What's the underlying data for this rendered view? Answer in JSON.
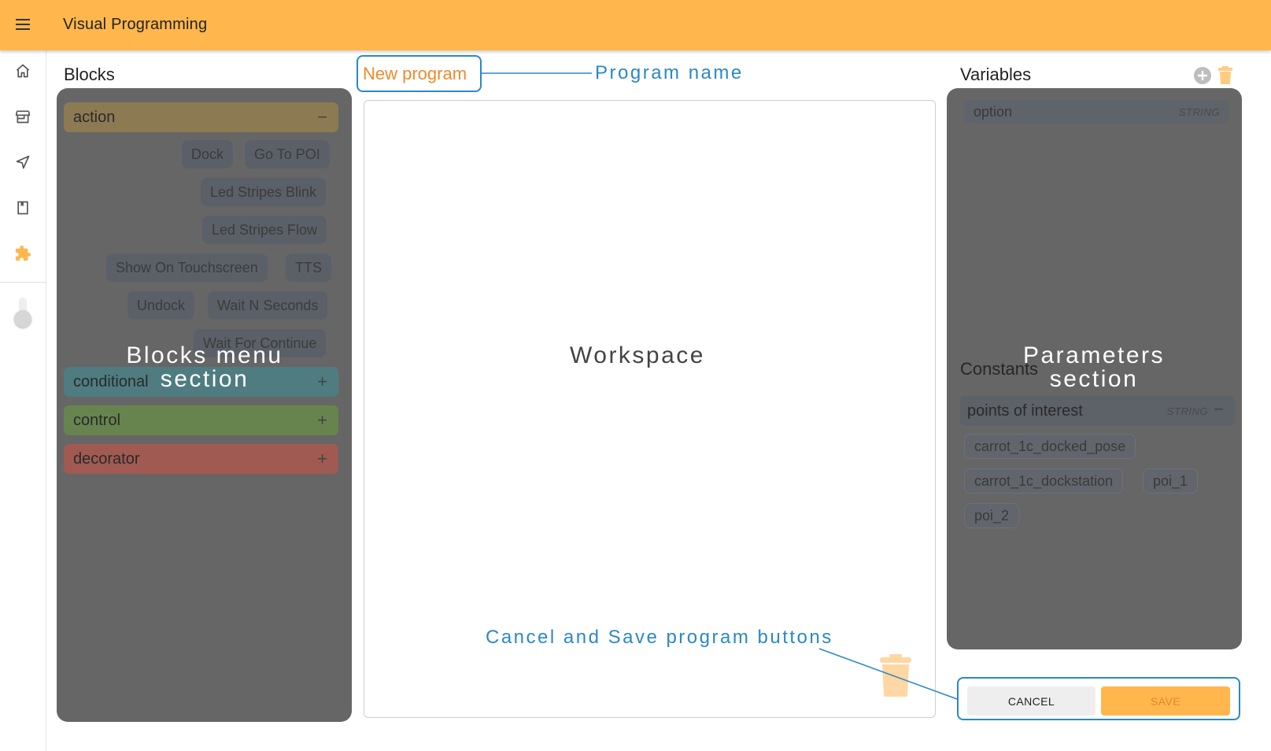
{
  "app": {
    "title": "Visual Programming"
  },
  "nav": {
    "items": [
      {
        "icon": "home-icon"
      },
      {
        "icon": "store-icon"
      },
      {
        "icon": "send-icon"
      },
      {
        "icon": "bookmark-icon"
      },
      {
        "icon": "puzzle-icon"
      }
    ],
    "accent": "#ffb74d"
  },
  "headings": {
    "blocks": "Blocks",
    "variables": "Variables",
    "constants": "Constants"
  },
  "program": {
    "name": "New program"
  },
  "blocks": {
    "categories": [
      {
        "label": "action",
        "sign": "−",
        "color": "#8c7b52"
      },
      {
        "label": "conditional",
        "sign": "+",
        "color": "#4f7c80"
      },
      {
        "label": "control",
        "sign": "+",
        "color": "#67844f"
      },
      {
        "label": "decorator",
        "sign": "+",
        "color": "#a05a52"
      }
    ],
    "actions": [
      "Dock",
      "Go To POI",
      "Led Stripes Blink",
      "Led Stripes Flow",
      "Show On Touchscreen",
      "TTS",
      "Undock",
      "Wait N Seconds",
      "Wait For Continue"
    ]
  },
  "variables": [
    {
      "name": "option",
      "type": "STRING"
    }
  ],
  "constants": {
    "group": {
      "name": "points of interest",
      "type": "STRING",
      "sign": "−"
    },
    "values": [
      "carrot_1c_docked_pose",
      "carrot_1c_dockstation",
      "poi_1",
      "poi_2"
    ]
  },
  "buttons": {
    "cancel": "CANCEL",
    "save": "SAVE"
  },
  "annotations": {
    "program_name": "Program name",
    "blocks_menu": "Blocks menu section",
    "workspace": "Workspace",
    "parameters": "Parameters section",
    "buttons": "Cancel and Save program buttons"
  }
}
